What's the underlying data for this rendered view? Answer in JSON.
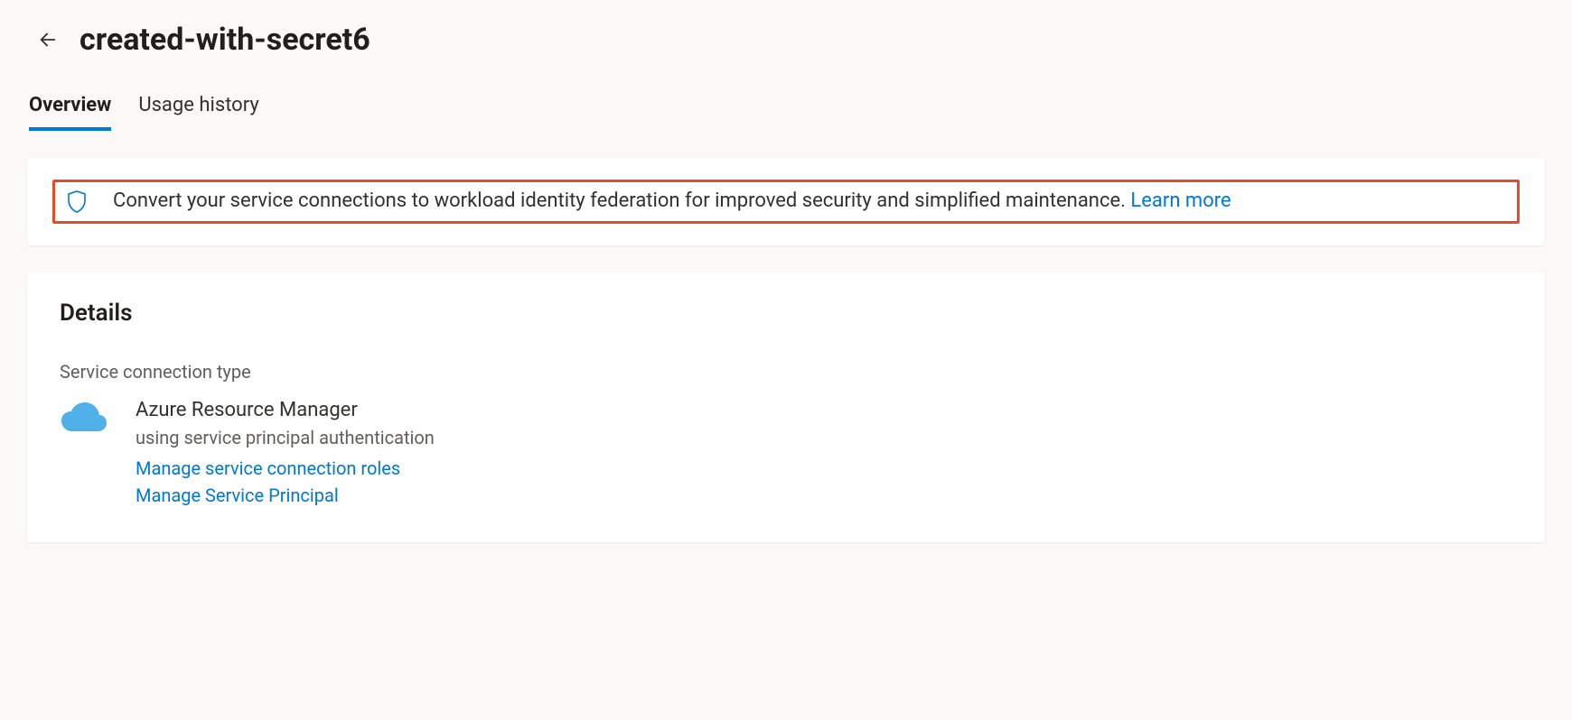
{
  "header": {
    "title": "created-with-secret6"
  },
  "tabs": [
    {
      "label": "Overview",
      "active": true
    },
    {
      "label": "Usage history",
      "active": false
    }
  ],
  "banner": {
    "text": "Convert your service connections to workload identity federation for improved security and simplified maintenance. ",
    "link_label": "Learn more"
  },
  "details": {
    "heading": "Details",
    "field_label": "Service connection type",
    "connection_type": "Azure Resource Manager",
    "auth_method": "using service principal authentication",
    "manage_roles_link": "Manage service connection roles",
    "manage_principal_link": "Manage Service Principal"
  },
  "colors": {
    "accent": "#0078d4",
    "highlight_border": "#e34c26"
  }
}
